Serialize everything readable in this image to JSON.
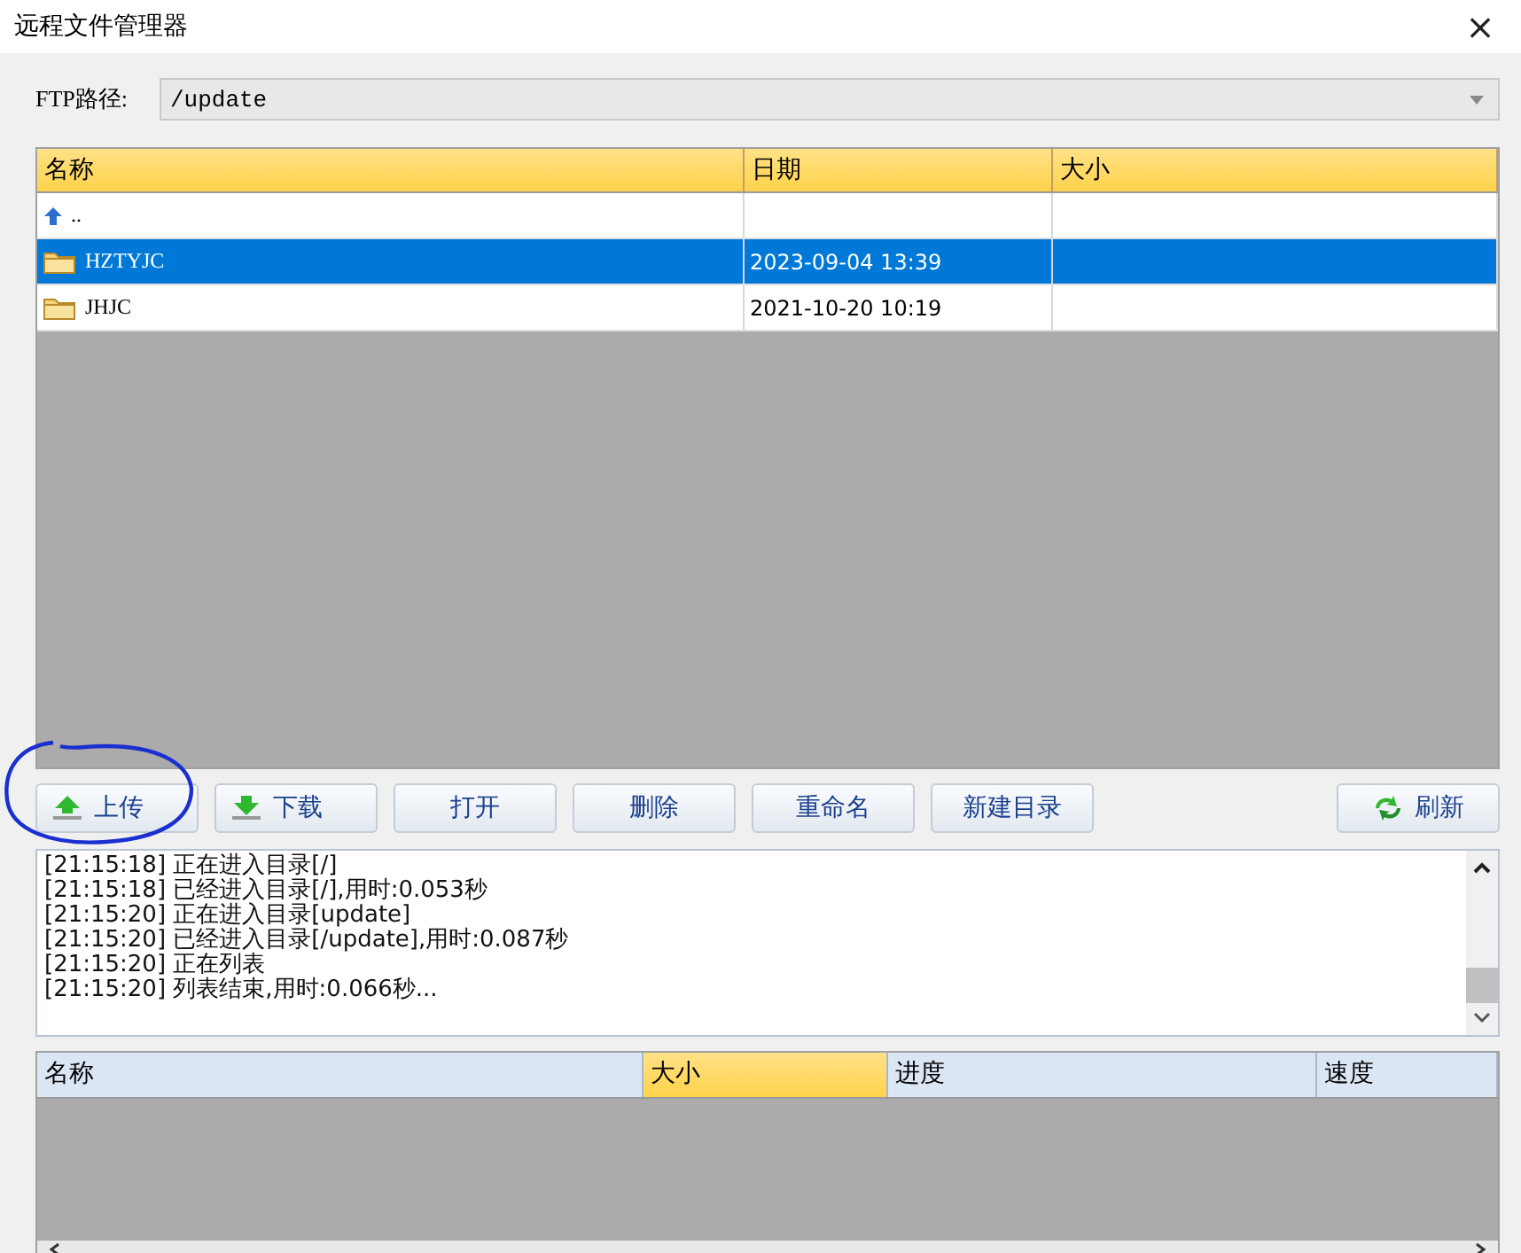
{
  "window": {
    "title": "远程文件管理器",
    "close": "×"
  },
  "path": {
    "label": "FTP路径:",
    "value": "/update"
  },
  "file_table": {
    "columns": [
      {
        "label": "名称",
        "highlighted": true
      },
      {
        "label": "日期",
        "highlighted": true
      },
      {
        "label": "大小",
        "highlighted": true
      }
    ],
    "rows": [
      {
        "kind": "up",
        "name": "..",
        "date": "",
        "selected": false
      },
      {
        "kind": "folder",
        "name": "HZTYJC",
        "date": "2023-09-04 13:39",
        "selected": true
      },
      {
        "kind": "folder",
        "name": "JHJC",
        "date": "2021-10-20 10:19",
        "selected": false
      }
    ]
  },
  "buttons": [
    {
      "kind": "upload",
      "label": "上传"
    },
    {
      "kind": "download",
      "label": "下载"
    },
    {
      "kind": "plain",
      "label": "打开"
    },
    {
      "kind": "plain",
      "label": "删除"
    },
    {
      "kind": "plain",
      "label": "重命名"
    },
    {
      "kind": "plain",
      "label": "新建目录"
    },
    {
      "kind": "refresh",
      "label": "刷新"
    }
  ],
  "log": [
    "[21:15:18] 正在进入目录[/]",
    "[21:15:18] 已经进入目录[/],用时:0.053秒",
    "[21:15:20] 正在进入目录[update]",
    "[21:15:20] 已经进入目录[/update],用时:0.087秒",
    "[21:15:20] 正在列表",
    "[21:15:20] 列表结束,用时:0.066秒..."
  ],
  "transfer_table": {
    "columns": [
      {
        "label": "名称",
        "highlighted": false
      },
      {
        "label": "大小",
        "highlighted": true
      },
      {
        "label": "进度",
        "highlighted": false
      },
      {
        "label": "速度",
        "highlighted": false
      }
    ]
  },
  "annotation": {
    "kind": "circle"
  }
}
